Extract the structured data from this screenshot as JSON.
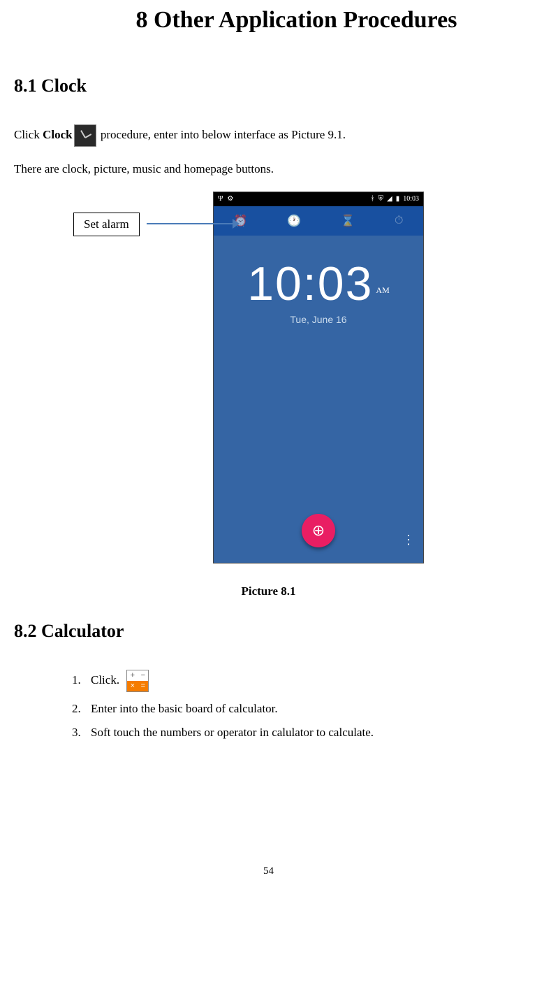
{
  "heading_main": "8 Other Application Procedures",
  "section_clock": {
    "title": "8.1 Clock",
    "line1a": "Click ",
    "line1b": "Clock",
    "line1c": " procedure, enter into below interface as Picture 9.1.",
    "line2": "There are clock, picture, music and homepage buttons.",
    "callout": "Set alarm",
    "screenshot": {
      "status_time": "10:03",
      "tabs_icons": [
        "⏰",
        "🕐",
        "⌛",
        "⏱"
      ],
      "time_main": "10:03",
      "time_ampm": "AM",
      "date": "Tue, June 16",
      "globe": "⊕",
      "kebab": "⋮"
    },
    "caption": "Picture 8.1"
  },
  "section_calc": {
    "title": "8.2 Calculator",
    "items": [
      "Click.",
      "Enter into the basic board of calculator.",
      "Soft touch the numbers or operator in calulator to calculate."
    ]
  },
  "page_number": "54"
}
